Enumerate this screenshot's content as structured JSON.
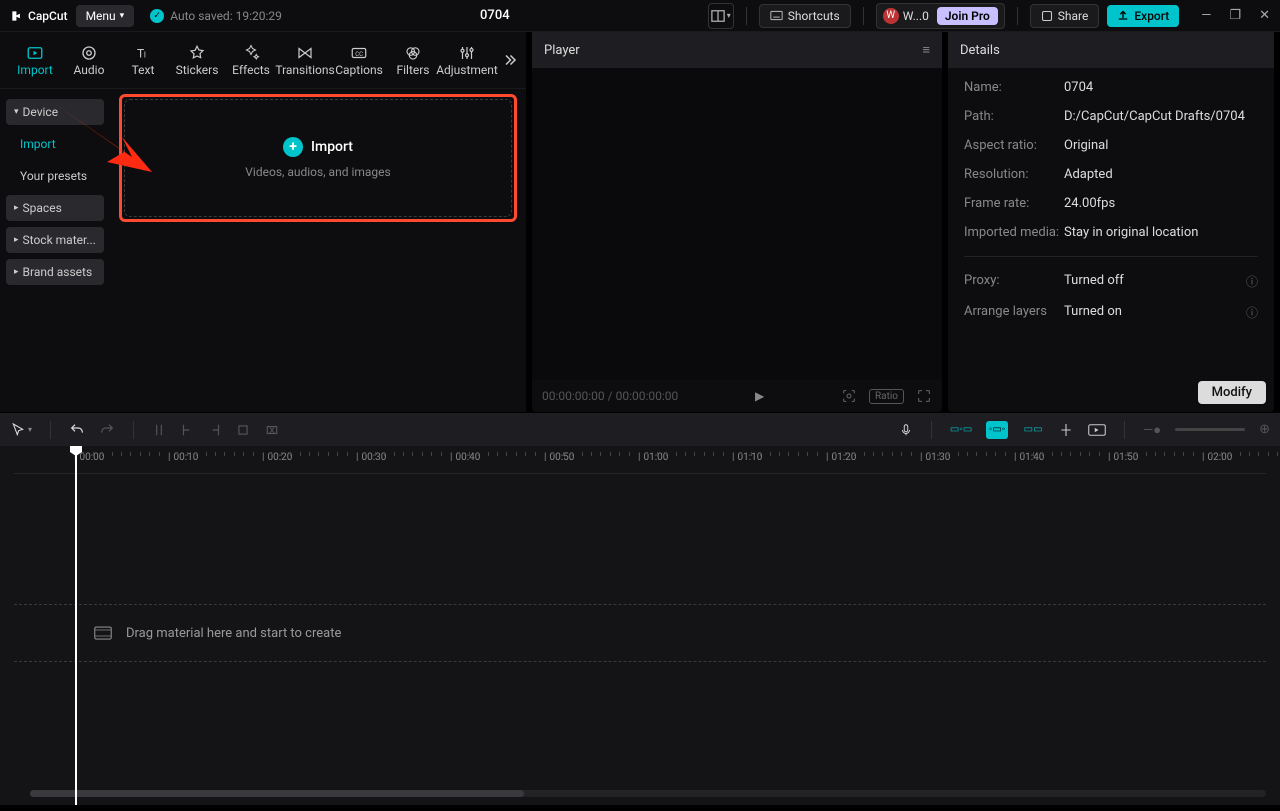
{
  "titlebar": {
    "logo": "CapCut",
    "menu": "Menu",
    "autosave": "Auto saved: 19:20:29",
    "project": "0704",
    "shortcuts": "Shortcuts",
    "user": "W...0",
    "joinpro": "Join Pro",
    "share": "Share",
    "export": "Export"
  },
  "tabs": [
    "Import",
    "Audio",
    "Text",
    "Stickers",
    "Effects",
    "Transitions",
    "Captions",
    "Filters",
    "Adjustment"
  ],
  "sidebar": {
    "device": "Device",
    "import": "Import",
    "presets": "Your presets",
    "spaces": "Spaces",
    "stock": "Stock mater...",
    "brand": "Brand assets"
  },
  "importBox": {
    "title": "Import",
    "sub": "Videos, audios, and images"
  },
  "player": {
    "title": "Player",
    "time": "00:00:00:00 / 00:00:00:00",
    "ratio": "Ratio"
  },
  "details": {
    "title": "Details",
    "name_k": "Name:",
    "name_v": "0704",
    "path_k": "Path:",
    "path_v": "D:/CapCut/CapCut Drafts/0704",
    "aspect_k": "Aspect ratio:",
    "aspect_v": "Original",
    "res_k": "Resolution:",
    "res_v": "Adapted",
    "fps_k": "Frame rate:",
    "fps_v": "24.00fps",
    "media_k": "Imported media:",
    "media_v": "Stay in original location",
    "proxy_k": "Proxy:",
    "proxy_v": "Turned off",
    "layers_k": "Arrange layers",
    "layers_v": "Turned on",
    "modify": "Modify"
  },
  "timeline": {
    "ticks": [
      "00:00",
      "00:10",
      "00:20",
      "00:30",
      "00:40",
      "00:50",
      "01:00",
      "01:10",
      "01:20",
      "01:30",
      "01:40",
      "01:50",
      "02:00"
    ],
    "hint": "Drag material here and start to create"
  }
}
